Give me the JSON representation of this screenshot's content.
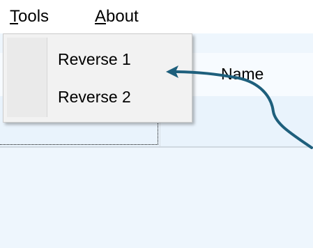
{
  "menubar": {
    "tools": {
      "prefix": "",
      "mnemonic": "T",
      "rest": "ools"
    },
    "about": {
      "prefix": "",
      "mnemonic": "A",
      "rest": "bout"
    }
  },
  "grid": {
    "header_name": "Name"
  },
  "dropdown": {
    "items": [
      {
        "label": "Reverse 1"
      },
      {
        "label": "Reverse 2"
      }
    ]
  },
  "colors": {
    "arrow": "#1e5f7c",
    "background": "#eef6fd"
  },
  "icons": [
    "curved-arrow-annotation"
  ]
}
